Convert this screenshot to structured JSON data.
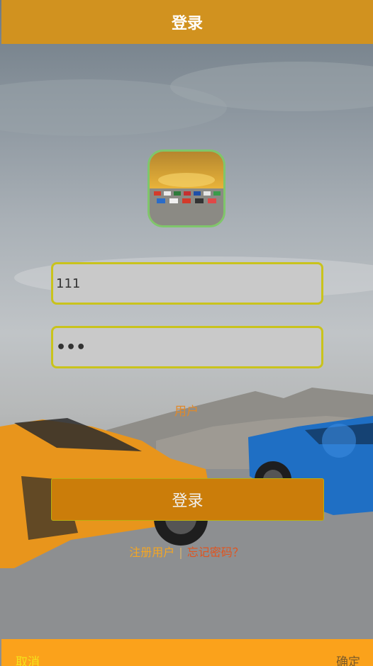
{
  "header": {
    "title": "登录"
  },
  "form": {
    "username_value": "111",
    "password_value": "•••",
    "role_label": "用户",
    "login_label": "登录"
  },
  "links": {
    "register": "注册用户",
    "separator": "|",
    "forgot": "忘记密码？"
  },
  "footer": {
    "cancel": "取消",
    "confirm": "确定"
  },
  "colors": {
    "header_bg": "#d1921f",
    "login_button_bg": "#cb7d0a",
    "input_border": "#c9c31c",
    "footer_bg": "#fba21b"
  }
}
